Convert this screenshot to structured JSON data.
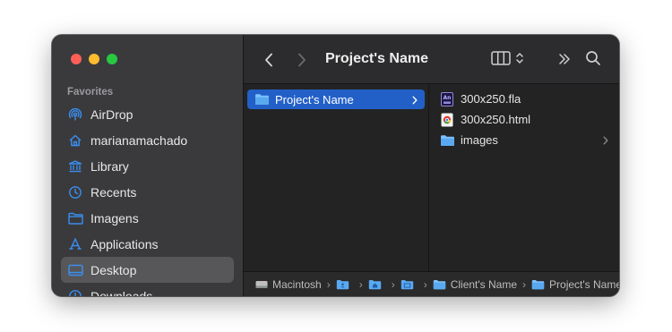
{
  "sidebar": {
    "section_title": "Favorites",
    "items": [
      {
        "label": "AirDrop",
        "icon": "airdrop-icon"
      },
      {
        "label": "marianamachado",
        "icon": "home-icon"
      },
      {
        "label": "Library",
        "icon": "library-icon"
      },
      {
        "label": "Recents",
        "icon": "clock-icon"
      },
      {
        "label": "Imagens",
        "icon": "folder-icon"
      },
      {
        "label": "Applications",
        "icon": "applications-icon"
      },
      {
        "label": "Desktop",
        "icon": "desktop-icon",
        "selected": true
      },
      {
        "label": "Downloads",
        "icon": "downloads-icon"
      }
    ]
  },
  "toolbar": {
    "title": "Project's Name"
  },
  "columns": {
    "first": [
      {
        "label": "Project's Name",
        "icon": "folder-icon",
        "selected": true
      }
    ],
    "second": [
      {
        "label": "300x250.fla",
        "icon": "animate-file-icon"
      },
      {
        "label": "300x250.html",
        "icon": "chrome-html-file-icon"
      },
      {
        "label": "images",
        "icon": "folder-icon"
      }
    ]
  },
  "pathbar": {
    "crumbs": [
      {
        "label": "Macintosh",
        "icon": "disk-icon"
      },
      {
        "label": "",
        "icon": "user-folder-icon"
      },
      {
        "label": "",
        "icon": "user-folder-icon"
      },
      {
        "label": "",
        "icon": "desktop-folder-icon"
      },
      {
        "label": "Client's Name",
        "icon": "folder-icon"
      },
      {
        "label": "Project's Name",
        "icon": "folder-icon"
      }
    ]
  },
  "colors": {
    "accent": "#2260c8",
    "sidebar_icon": "#3b8ef0",
    "folder": "#5aa9f0"
  }
}
